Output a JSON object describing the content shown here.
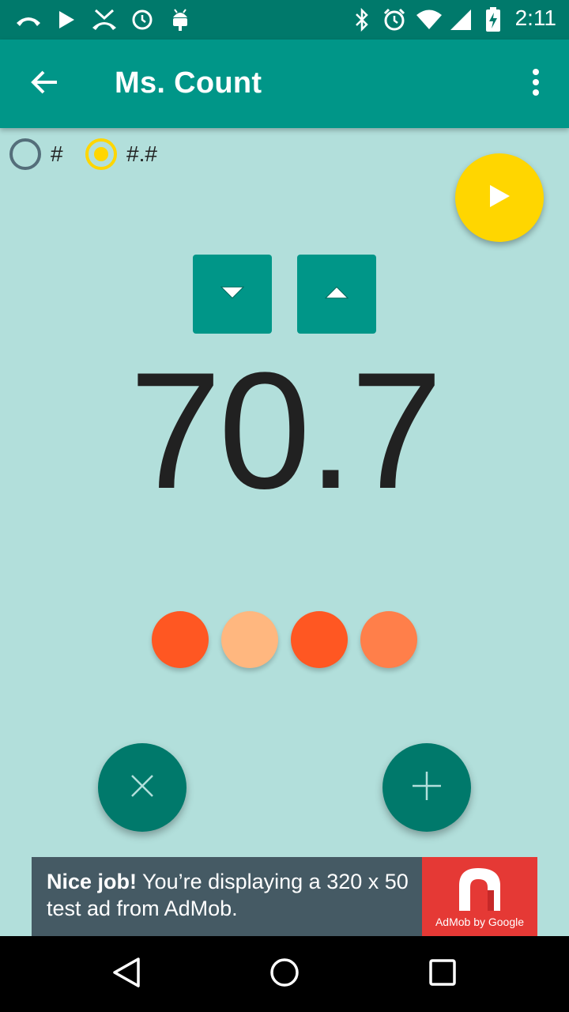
{
  "status_bar": {
    "time": "2:11",
    "left_icons": [
      "missed-call-icon",
      "play-store-icon",
      "call-end-icon",
      "alarm-clock-icon",
      "android-icon"
    ],
    "right_icons": [
      "bluetooth-icon",
      "alarm-icon",
      "wifi-icon",
      "cell-signal-icon",
      "battery-charging-icon"
    ]
  },
  "app_bar": {
    "title": "Ms. Count",
    "back_icon": "arrow-back-icon",
    "menu_icon": "more-vert-icon"
  },
  "format_options": [
    {
      "label": "#",
      "selected": false
    },
    {
      "label": "#.#",
      "selected": true
    }
  ],
  "counter": {
    "value": "70.7"
  },
  "indicators": {
    "colors": [
      "#ff5722",
      "#ffb77f",
      "#ff5722",
      "#ff7f4a"
    ]
  },
  "actions": {
    "play": "play-icon",
    "decrement": "arrow-down-icon",
    "increment": "arrow-up-icon",
    "clear": "close-icon",
    "add": "add-icon"
  },
  "ad": {
    "headline": "Nice job!",
    "body": " You’re displaying a 320 x 50 test ad from AdMob.",
    "logo_caption": "AdMob by Google"
  },
  "colors": {
    "status_bar": "#00796b",
    "app_bar": "#009688",
    "background": "#b2dfdb",
    "accent": "#ffd600",
    "fab": "#00796b"
  }
}
